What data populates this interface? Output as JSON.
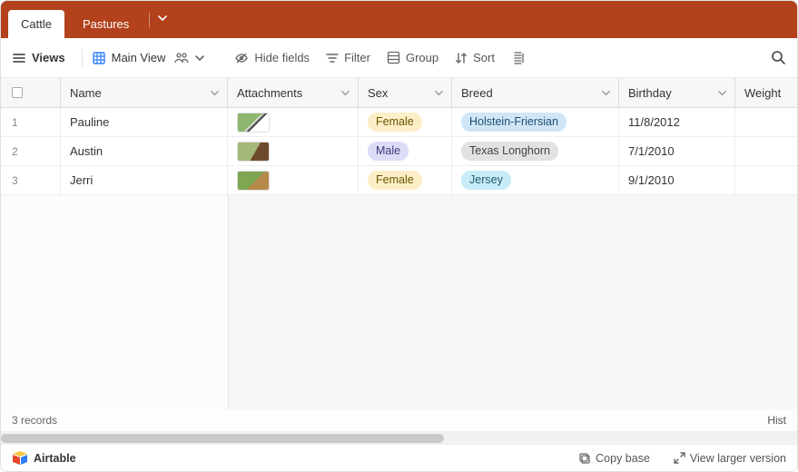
{
  "tabs": {
    "items": [
      {
        "label": "Cattle",
        "active": true
      },
      {
        "label": "Pastures",
        "active": false
      }
    ]
  },
  "toolbar": {
    "views": "Views",
    "main_view": "Main View",
    "hide_fields": "Hide fields",
    "filter": "Filter",
    "group": "Group",
    "sort": "Sort"
  },
  "columns": {
    "name": "Name",
    "attachments": "Attachments",
    "sex": "Sex",
    "breed": "Breed",
    "birthday": "Birthday",
    "weight": "Weight"
  },
  "rows": [
    {
      "num": "1",
      "name": "Pauline",
      "sex": "Female",
      "sex_cls": "female",
      "breed": "Holstein-Friersian",
      "breed_cls": "breed1",
      "birthday": "11/8/2012",
      "thumb": "linear-gradient(135deg,#8fb66f 0%,#8fb66f 50%,#fff 50%,#000 60%, #fff 60%)"
    },
    {
      "num": "2",
      "name": "Austin",
      "sex": "Male",
      "sex_cls": "male",
      "breed": "Texas Longhorn",
      "breed_cls": "breed2",
      "birthday": "7/1/2010",
      "thumb": "linear-gradient(120deg,#a5b87a 0%,#a5b87a 55%,#6e4a2d 55%)"
    },
    {
      "num": "3",
      "name": "Jerri",
      "sex": "Female",
      "sex_cls": "female",
      "breed": "Jersey",
      "breed_cls": "breed3",
      "birthday": "9/1/2010",
      "thumb": "linear-gradient(135deg,#7ea653 0%,#7ea653 55%,#b58a4a 55%)"
    }
  ],
  "status": {
    "records": "3 records",
    "right": "Hist"
  },
  "footer": {
    "brand": "Airtable",
    "copy": "Copy base",
    "larger": "View larger version"
  }
}
